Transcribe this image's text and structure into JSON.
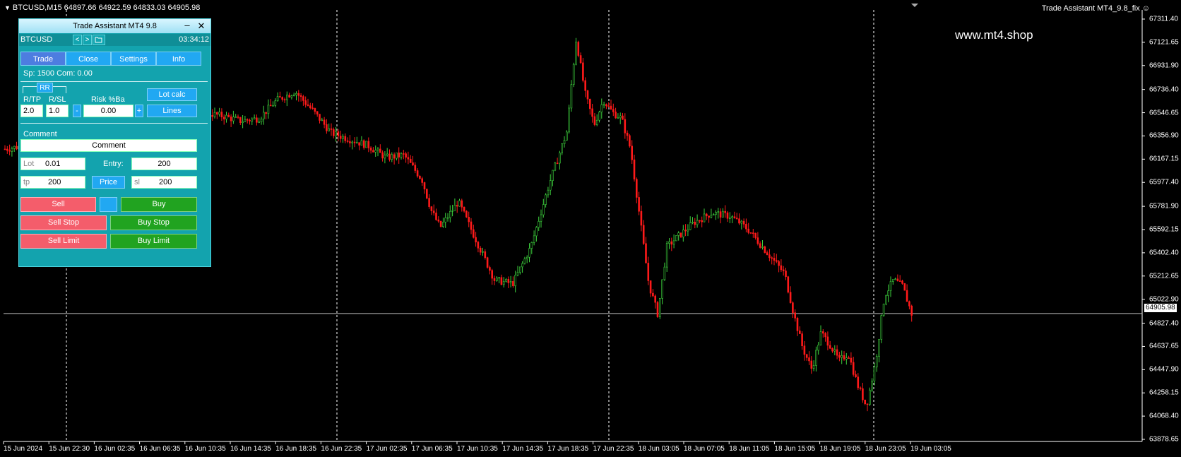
{
  "header": {
    "symbol_info": "BTCUSD,M15  64897.66 64922.59 64833.03 64905.98",
    "ea_label": "Trade Assistant MT4_9.8_fix"
  },
  "watermark": "www.mt4.shop",
  "chart_data": {
    "type": "candlestick",
    "symbol": "BTCUSD",
    "timeframe": "M15",
    "ohlc_current": {
      "open": 64897.66,
      "high": 64922.59,
      "low": 64833.03,
      "close": 64905.98
    },
    "current_price": "64905.98",
    "colors": {
      "bull": "#3dd13d",
      "bear": "#ff1a1a",
      "grid": "#ffffff",
      "background": "#000000"
    },
    "price_axis": [
      "67311.40",
      "67121.65",
      "66931.90",
      "66736.40",
      "66546.65",
      "66356.90",
      "66167.15",
      "65977.40",
      "65781.90",
      "65592.15",
      "65402.40",
      "65212.65",
      "65022.90",
      "64827.40",
      "64637.65",
      "64447.90",
      "64258.15",
      "64068.40",
      "63878.65"
    ],
    "time_axis": [
      "15 Jun 2024",
      "15 Jun 22:30",
      "16 Jun 02:35",
      "16 Jun 06:35",
      "16 Jun 10:35",
      "16 Jun 14:35",
      "16 Jun 18:35",
      "16 Jun 22:35",
      "17 Jun 02:35",
      "17 Jun 06:35",
      "17 Jun 10:35",
      "17 Jun 14:35",
      "17 Jun 18:35",
      "17 Jun 22:35",
      "18 Jun 03:05",
      "18 Jun 07:05",
      "18 Jun 11:05",
      "18 Jun 15:05",
      "18 Jun 19:05",
      "18 Jun 23:05",
      "19 Jun 03:05"
    ],
    "ylim": [
      63878.65,
      67311.4
    ],
    "price_path": [
      [
        0,
        66250
      ],
      [
        0.04,
        66300
      ],
      [
        0.06,
        66480
      ],
      [
        0.1,
        66610
      ],
      [
        0.14,
        66640
      ],
      [
        0.18,
        66590
      ],
      [
        0.21,
        66560
      ],
      [
        0.24,
        66520
      ],
      [
        0.26,
        66480
      ],
      [
        0.28,
        66500
      ],
      [
        0.3,
        66650
      ],
      [
        0.32,
        66720
      ],
      [
        0.34,
        66560
      ],
      [
        0.36,
        66380
      ],
      [
        0.38,
        66330
      ],
      [
        0.4,
        66280
      ],
      [
        0.42,
        66180
      ],
      [
        0.44,
        66200
      ],
      [
        0.46,
        66000
      ],
      [
        0.47,
        65750
      ],
      [
        0.48,
        65610
      ],
      [
        0.5,
        65820
      ],
      [
        0.52,
        65500
      ],
      [
        0.54,
        65180
      ],
      [
        0.56,
        65150
      ],
      [
        0.58,
        65450
      ],
      [
        0.6,
        65960
      ],
      [
        0.62,
        66400
      ],
      [
        0.625,
        66800
      ],
      [
        0.63,
        67150
      ],
      [
        0.64,
        66700
      ],
      [
        0.65,
        66450
      ],
      [
        0.66,
        66650
      ],
      [
        0.67,
        66550
      ],
      [
        0.68,
        66500
      ],
      [
        0.69,
        66250
      ],
      [
        0.7,
        65700
      ],
      [
        0.71,
        65150
      ],
      [
        0.72,
        64900
      ],
      [
        0.73,
        65450
      ],
      [
        0.74,
        65520
      ],
      [
        0.76,
        65650
      ],
      [
        0.78,
        65730
      ],
      [
        0.8,
        65700
      ],
      [
        0.81,
        65650
      ],
      [
        0.82,
        65590
      ],
      [
        0.84,
        65410
      ],
      [
        0.86,
        65230
      ],
      [
        0.87,
        64900
      ],
      [
        0.88,
        64620
      ],
      [
        0.89,
        64450
      ],
      [
        0.9,
        64750
      ],
      [
        0.91,
        64650
      ],
      [
        0.92,
        64520
      ],
      [
        0.93,
        64580
      ],
      [
        0.94,
        64330
      ],
      [
        0.95,
        64150
      ],
      [
        0.96,
        64500
      ],
      [
        0.97,
        65050
      ],
      [
        0.98,
        65180
      ],
      [
        0.99,
        65130
      ],
      [
        1.0,
        64905
      ]
    ]
  },
  "panel": {
    "title": "Trade Assistant MT4 9.8",
    "minimize": "–",
    "close": "✕",
    "symbol": "BTCUSD",
    "nav_prev": "<",
    "nav_next": ">",
    "folder_icon": "folder-icon",
    "time": "03:34:12",
    "tabs": [
      "Trade",
      "Close",
      "Settings",
      "Info"
    ],
    "spread_info": "Sp: 1500  Com: 0.00",
    "rr_label": "RR",
    "rtp_label": "R/TP",
    "rsl_label": "R/SL",
    "risk_label": "Risk %Ba",
    "rtp_value": "2.0",
    "rsl_value": "1.0",
    "minus": "-",
    "plus": "+",
    "risk_value": "0.00",
    "lot_calc": "Lot calc",
    "lines": "Lines",
    "comment_label": "Comment",
    "comment_value": "Comment",
    "lot_label": "Lot",
    "lot_value": "0.01",
    "entry_label": "Entry:",
    "entry_value": "200",
    "tp_label": "tp",
    "tp_value": "200",
    "price_button": "Price",
    "sl_label": "sl",
    "sl_value": "200",
    "sell": "Sell",
    "buy": "Buy",
    "sell_stop": "Sell Stop",
    "buy_stop": "Buy Stop",
    "sell_limit": "Sell Limit",
    "buy_limit": "Buy Limit"
  }
}
